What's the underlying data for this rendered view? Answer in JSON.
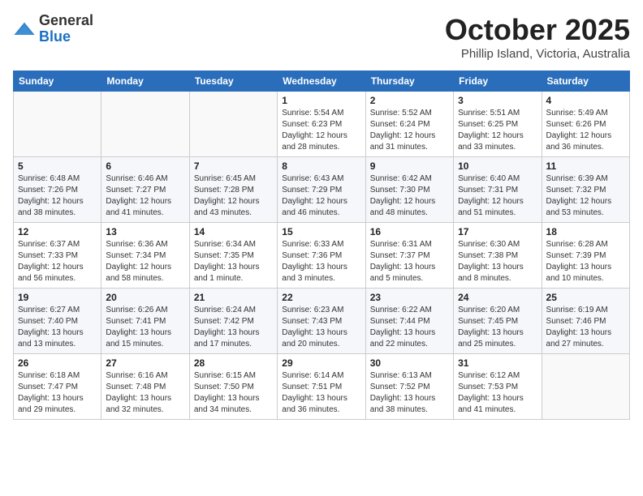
{
  "header": {
    "logo_general": "General",
    "logo_blue": "Blue",
    "month": "October 2025",
    "location": "Phillip Island, Victoria, Australia"
  },
  "weekdays": [
    "Sunday",
    "Monday",
    "Tuesday",
    "Wednesday",
    "Thursday",
    "Friday",
    "Saturday"
  ],
  "weeks": [
    [
      {
        "day": "",
        "info": ""
      },
      {
        "day": "",
        "info": ""
      },
      {
        "day": "",
        "info": ""
      },
      {
        "day": "1",
        "info": "Sunrise: 5:54 AM\nSunset: 6:23 PM\nDaylight: 12 hours\nand 28 minutes."
      },
      {
        "day": "2",
        "info": "Sunrise: 5:52 AM\nSunset: 6:24 PM\nDaylight: 12 hours\nand 31 minutes."
      },
      {
        "day": "3",
        "info": "Sunrise: 5:51 AM\nSunset: 6:25 PM\nDaylight: 12 hours\nand 33 minutes."
      },
      {
        "day": "4",
        "info": "Sunrise: 5:49 AM\nSunset: 6:26 PM\nDaylight: 12 hours\nand 36 minutes."
      }
    ],
    [
      {
        "day": "5",
        "info": "Sunrise: 6:48 AM\nSunset: 7:26 PM\nDaylight: 12 hours\nand 38 minutes."
      },
      {
        "day": "6",
        "info": "Sunrise: 6:46 AM\nSunset: 7:27 PM\nDaylight: 12 hours\nand 41 minutes."
      },
      {
        "day": "7",
        "info": "Sunrise: 6:45 AM\nSunset: 7:28 PM\nDaylight: 12 hours\nand 43 minutes."
      },
      {
        "day": "8",
        "info": "Sunrise: 6:43 AM\nSunset: 7:29 PM\nDaylight: 12 hours\nand 46 minutes."
      },
      {
        "day": "9",
        "info": "Sunrise: 6:42 AM\nSunset: 7:30 PM\nDaylight: 12 hours\nand 48 minutes."
      },
      {
        "day": "10",
        "info": "Sunrise: 6:40 AM\nSunset: 7:31 PM\nDaylight: 12 hours\nand 51 minutes."
      },
      {
        "day": "11",
        "info": "Sunrise: 6:39 AM\nSunset: 7:32 PM\nDaylight: 12 hours\nand 53 minutes."
      }
    ],
    [
      {
        "day": "12",
        "info": "Sunrise: 6:37 AM\nSunset: 7:33 PM\nDaylight: 12 hours\nand 56 minutes."
      },
      {
        "day": "13",
        "info": "Sunrise: 6:36 AM\nSunset: 7:34 PM\nDaylight: 12 hours\nand 58 minutes."
      },
      {
        "day": "14",
        "info": "Sunrise: 6:34 AM\nSunset: 7:35 PM\nDaylight: 13 hours\nand 1 minute."
      },
      {
        "day": "15",
        "info": "Sunrise: 6:33 AM\nSunset: 7:36 PM\nDaylight: 13 hours\nand 3 minutes."
      },
      {
        "day": "16",
        "info": "Sunrise: 6:31 AM\nSunset: 7:37 PM\nDaylight: 13 hours\nand 5 minutes."
      },
      {
        "day": "17",
        "info": "Sunrise: 6:30 AM\nSunset: 7:38 PM\nDaylight: 13 hours\nand 8 minutes."
      },
      {
        "day": "18",
        "info": "Sunrise: 6:28 AM\nSunset: 7:39 PM\nDaylight: 13 hours\nand 10 minutes."
      }
    ],
    [
      {
        "day": "19",
        "info": "Sunrise: 6:27 AM\nSunset: 7:40 PM\nDaylight: 13 hours\nand 13 minutes."
      },
      {
        "day": "20",
        "info": "Sunrise: 6:26 AM\nSunset: 7:41 PM\nDaylight: 13 hours\nand 15 minutes."
      },
      {
        "day": "21",
        "info": "Sunrise: 6:24 AM\nSunset: 7:42 PM\nDaylight: 13 hours\nand 17 minutes."
      },
      {
        "day": "22",
        "info": "Sunrise: 6:23 AM\nSunset: 7:43 PM\nDaylight: 13 hours\nand 20 minutes."
      },
      {
        "day": "23",
        "info": "Sunrise: 6:22 AM\nSunset: 7:44 PM\nDaylight: 13 hours\nand 22 minutes."
      },
      {
        "day": "24",
        "info": "Sunrise: 6:20 AM\nSunset: 7:45 PM\nDaylight: 13 hours\nand 25 minutes."
      },
      {
        "day": "25",
        "info": "Sunrise: 6:19 AM\nSunset: 7:46 PM\nDaylight: 13 hours\nand 27 minutes."
      }
    ],
    [
      {
        "day": "26",
        "info": "Sunrise: 6:18 AM\nSunset: 7:47 PM\nDaylight: 13 hours\nand 29 minutes."
      },
      {
        "day": "27",
        "info": "Sunrise: 6:16 AM\nSunset: 7:48 PM\nDaylight: 13 hours\nand 32 minutes."
      },
      {
        "day": "28",
        "info": "Sunrise: 6:15 AM\nSunset: 7:50 PM\nDaylight: 13 hours\nand 34 minutes."
      },
      {
        "day": "29",
        "info": "Sunrise: 6:14 AM\nSunset: 7:51 PM\nDaylight: 13 hours\nand 36 minutes."
      },
      {
        "day": "30",
        "info": "Sunrise: 6:13 AM\nSunset: 7:52 PM\nDaylight: 13 hours\nand 38 minutes."
      },
      {
        "day": "31",
        "info": "Sunrise: 6:12 AM\nSunset: 7:53 PM\nDaylight: 13 hours\nand 41 minutes."
      },
      {
        "day": "",
        "info": ""
      }
    ]
  ]
}
